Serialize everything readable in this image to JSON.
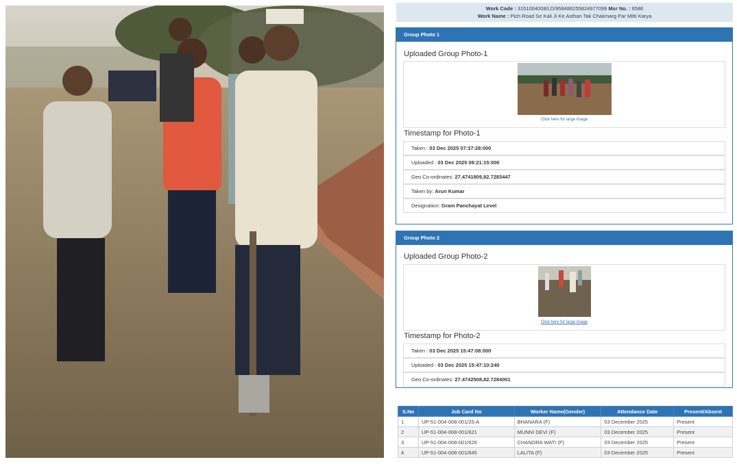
{
  "header": {
    "work_code_label": "Work Code :",
    "work_code": "3151004008/LD/958486255824977099",
    "msr_label": "Msr No. :",
    "msr_no": "6586",
    "work_name_label": "Work Name :",
    "work_name": "Pich Road Se Kali Ji Ke Asthan Tak Chakmarg Par Mitti Karya"
  },
  "photo1": {
    "section_title": "Group Photo 1",
    "uploaded_title": "Uploaded Group Photo-1",
    "link_text": "Click here for large image",
    "timestamp_title": "Timestamp for Photo-1",
    "rows": [
      {
        "label": "Taken :",
        "value": "03 Dec 2025 07:37:28:000"
      },
      {
        "label": "Uploaded :",
        "value": "03 Dec 2025 08:21:15:000"
      },
      {
        "label": "Geo Co-ordinates:",
        "value": "27.4741809,82.7283447"
      },
      {
        "label": "Taken by:",
        "value": "Arun Kumar"
      },
      {
        "label": "Designation:",
        "value": "Gram Panchayat Level"
      }
    ]
  },
  "photo2": {
    "section_title": "Group Photo 2",
    "uploaded_title": "Uploaded Group Photo-2",
    "link_text": "Click here for large image",
    "timestamp_title": "Timestamp for Photo-2",
    "rows": [
      {
        "label": "Taken :",
        "value": "03 Dec 2025 15:47:08:000"
      },
      {
        "label": "Uploaded :",
        "value": "03 Dec 2025 15:47:10:240"
      },
      {
        "label": "Geo Co-ordinates:",
        "value": "27.4742508,82.7284001"
      }
    ]
  },
  "attendance": {
    "columns": [
      "S.No",
      "Job Card No",
      "Worker Name(Gender)",
      "Attendance Date",
      "Present/Absent"
    ],
    "rows": [
      [
        "1",
        "UP-51-004-008-001/25-A",
        "BHANARA (F)",
        "03 December 2025",
        "Present"
      ],
      [
        "2",
        "UP-51-004-008-001/621",
        "MUNNI DEVI (F)",
        "03 December 2025",
        "Present"
      ],
      [
        "3",
        "UP-51-004-008-001/626",
        "CHANDRA WATI (F)",
        "03 December 2025",
        "Present"
      ],
      [
        "4",
        "UP-51-004-008-001/645",
        "LALITA (F)",
        "03 December 2025",
        "Present"
      ]
    ]
  },
  "colors": {
    "accent": "#2e74b5",
    "header_bg": "#dde7ef"
  }
}
